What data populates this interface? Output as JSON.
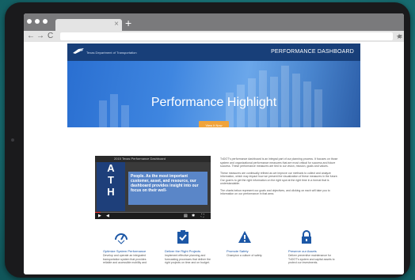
{
  "colors": {
    "brand_blue": "#1c57a6",
    "accent_orange": "#f0a33a",
    "background_teal": "#1c7a80"
  },
  "browser": {
    "tab_close_icon": "close-icon",
    "new_tab_icon": "plus-icon"
  },
  "header": {
    "org_name": "Texas Department of Transportation",
    "dashboard_title": "PERFORMANCE DASHBOARD"
  },
  "hero": {
    "title": "Performance Highlight",
    "button_label": "View It Now"
  },
  "video": {
    "title": "2015 Texas Performance Dashboard",
    "ath_letters": [
      "A",
      "T",
      "H"
    ],
    "quote": "People. As the most important customer, asset, and resource, our dashboard provides insight into our focus on their well-",
    "progress": 0.05
  },
  "description": {
    "paragraphs": [
      "TxDOT's performance dashboard is an integral part of our planning process. It focuses on those system and organizational performance measures that are most critical for success and future success. These performance measures are tied to our vision, mission, goals and values.",
      "These measures are continually refined as we improve our methods to collect and analyze information, which may impact how we present the visualization of these measures in the future. Our goal is to get the right information on the right spot at the right time in a format that is understandable.",
      "The charts below represent our goals and objectives, and clicking on each will take you to information on our performance in that area."
    ]
  },
  "cards": [
    {
      "icon": "gauge-icon",
      "title": "Optimize System Performance",
      "text": "Develop and operate an integrated transportation system that provides reliable and accessible mobility and"
    },
    {
      "icon": "checklist-icon",
      "title": "Deliver the Right Projects",
      "text": "Implement effective planning and forecasting processes that deliver the right projects on time and on budget."
    },
    {
      "icon": "warning-icon",
      "title": "Promote Safety",
      "text": "Champion a culture of safety."
    },
    {
      "icon": "lock-icon",
      "title": "Preserve our Assets",
      "text": "Deliver preventive maintenance for TxDOT's system and capital assets to protect our investments."
    }
  ]
}
